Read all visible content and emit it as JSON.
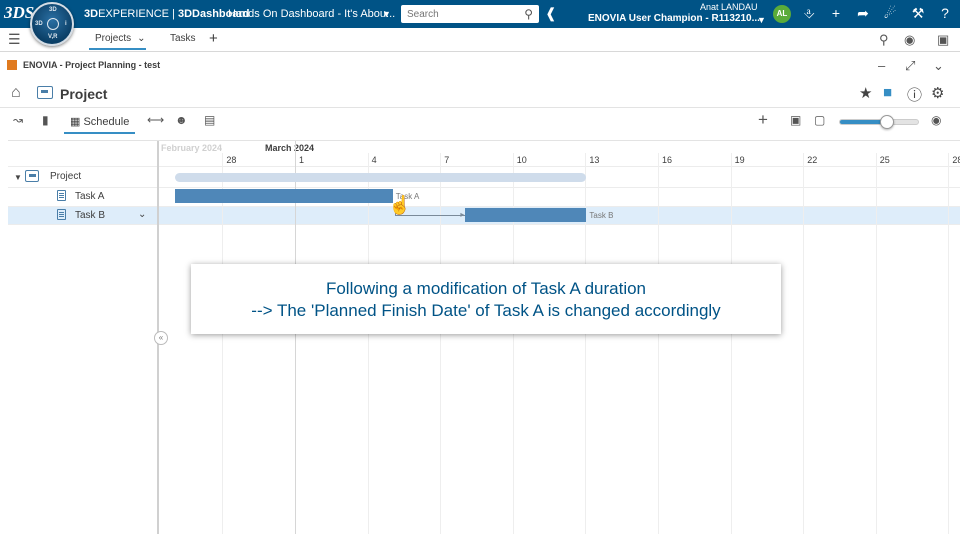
{
  "header": {
    "logo": "3DS",
    "compass": {
      "n": "3D",
      "w": "3D",
      "e": "i",
      "s": "V,R"
    },
    "brand_3d": "3D",
    "brand_exp": "EXPERIENCE",
    "brand_sep": " | ",
    "brand_dash": "3DDashboard",
    "dashboard_title": "Hands On Dashboard - It's Abou...",
    "search_placeholder": "Search",
    "user_name": "Anat LANDAU",
    "user_role": "ENOVIA User Champion - R113210...",
    "avatar": "AL"
  },
  "tabs": [
    {
      "label": "Projects"
    },
    {
      "label": "Tasks"
    }
  ],
  "app": {
    "title": "ENOVIA - Project Planning - test"
  },
  "head": {
    "title": "Project"
  },
  "toolbar": {
    "schedule_label": "Schedule",
    "slider_value": 0.6
  },
  "gantt": {
    "months": [
      {
        "label": "February 2024"
      },
      {
        "label": "March 2024"
      }
    ],
    "days": [
      "28",
      "1",
      "4",
      "7",
      "10",
      "13",
      "16",
      "19",
      "22",
      "25",
      "28"
    ],
    "rows": [
      {
        "label": "Project",
        "start": "2024-02-26",
        "end": "2024-03-14"
      },
      {
        "label": "Task A",
        "start": "2024-02-26",
        "end": "2024-03-06"
      },
      {
        "label": "Task B",
        "start": "2024-03-09",
        "end": "2024-03-14"
      }
    ],
    "bar_labels": [
      "Task A",
      "Task B"
    ]
  },
  "callout": {
    "line1": "Following a modification of Task A duration",
    "line2": "--> The 'Planned Finish Date' of Task A is changed accordingly"
  }
}
